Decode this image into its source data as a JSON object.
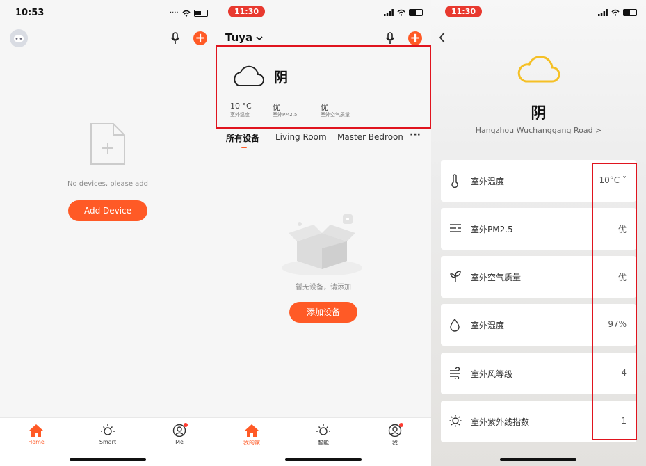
{
  "screen1": {
    "time": "10:53",
    "empty_text": "No devices, please add",
    "add_button": "Add Device",
    "tabs": [
      "Home",
      "Smart",
      "Me"
    ]
  },
  "screen2": {
    "time": "11:30",
    "home_name": "Tuya",
    "weather": {
      "condition": "阴",
      "temp_value": "10 °C",
      "temp_label": "室外温度",
      "pm_value": "优",
      "pm_label": "室外PM2.5",
      "aq_value": "优",
      "aq_label": "室外空气质量"
    },
    "room_tabs": [
      "所有设备",
      "Living Room",
      "Master Bedroom"
    ],
    "more": "···",
    "empty_text": "暂无设备，请添加",
    "add_button": "添加设备",
    "tabs": [
      "我的家",
      "智能",
      "我"
    ]
  },
  "screen3": {
    "time": "11:30",
    "condition": "阴",
    "location": "Hangzhou Wuchanggang Road >",
    "rows": [
      {
        "label": "室外温度",
        "value": "10°C ˅",
        "icon": "thermometer-icon"
      },
      {
        "label": "室外PM2.5",
        "value": "优",
        "icon": "pm-icon"
      },
      {
        "label": "室外空气质量",
        "value": "优",
        "icon": "leaf-icon"
      },
      {
        "label": "室外湿度",
        "value": "97%",
        "icon": "droplet-icon"
      },
      {
        "label": "室外风等级",
        "value": "4",
        "icon": "wind-icon"
      },
      {
        "label": "室外紫外线指数",
        "value": "1",
        "icon": "sun-icon"
      }
    ]
  },
  "colors": {
    "accent": "#ff5a26",
    "highlight": "#e0141e",
    "cloud": "#f5c026"
  }
}
